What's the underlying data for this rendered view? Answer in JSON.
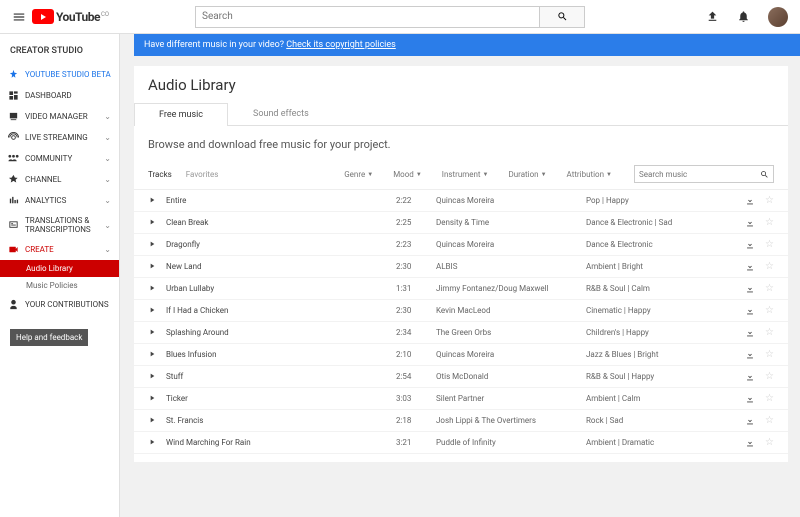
{
  "topbar": {
    "logo_text": "YouTube",
    "logo_sup": "CO",
    "search_placeholder": "Search"
  },
  "sidebar": {
    "title": "CREATOR STUDIO",
    "items": [
      {
        "label": "YOUTUBE STUDIO BETA",
        "cls": "beta"
      },
      {
        "label": "DASHBOARD"
      },
      {
        "label": "VIDEO MANAGER",
        "exp": true
      },
      {
        "label": "LIVE STREAMING",
        "exp": true
      },
      {
        "label": "COMMUNITY",
        "exp": true
      },
      {
        "label": "CHANNEL",
        "exp": true
      },
      {
        "label": "ANALYTICS",
        "exp": true
      },
      {
        "label": "TRANSLATIONS & TRANSCRIPTIONS",
        "exp": true
      },
      {
        "label": "CREATE",
        "cls": "create",
        "exp": true
      },
      {
        "label": "YOUR CONTRIBUTIONS"
      }
    ],
    "subs": [
      {
        "label": "Audio Library",
        "active": true
      },
      {
        "label": "Music Policies"
      }
    ],
    "help": "Help and feedback"
  },
  "banner": {
    "text": "Have different music in your video? ",
    "link": "Check its copyright policies"
  },
  "page": {
    "title": "Audio Library",
    "tabs": [
      {
        "label": "Free music",
        "active": true
      },
      {
        "label": "Sound effects"
      }
    ],
    "subtitle": "Browse and download free music for your project.",
    "filter_tabs": [
      {
        "label": "Tracks",
        "active": true
      },
      {
        "label": "Favorites"
      }
    ],
    "filters": [
      "Genre",
      "Mood",
      "Instrument",
      "Duration",
      "Attribution"
    ],
    "search_placeholder": "Search music"
  },
  "tracks": [
    {
      "name": "Entire",
      "dur": "2:22",
      "artist": "Quincas Moreira",
      "genre": "Pop | Happy"
    },
    {
      "name": "Clean Break",
      "dur": "2:25",
      "artist": "Density & Time",
      "genre": "Dance & Electronic | Sad"
    },
    {
      "name": "Dragonfly",
      "dur": "2:23",
      "artist": "Quincas Moreira",
      "genre": "Dance & Electronic"
    },
    {
      "name": "New Land",
      "dur": "2:30",
      "artist": "ALBIS",
      "genre": "Ambient | Bright"
    },
    {
      "name": "Urban Lullaby",
      "dur": "1:31",
      "artist": "Jimmy Fontanez/Doug Maxwell",
      "genre": "R&B & Soul | Calm"
    },
    {
      "name": "If I Had a Chicken",
      "dur": "2:30",
      "artist": "Kevin MacLeod",
      "genre": "Cinematic | Happy"
    },
    {
      "name": "Splashing Around",
      "dur": "2:34",
      "artist": "The Green Orbs",
      "genre": "Children's | Happy"
    },
    {
      "name": "Blues Infusion",
      "dur": "2:10",
      "artist": "Quincas Moreira",
      "genre": "Jazz & Blues | Bright"
    },
    {
      "name": "Stuff",
      "dur": "2:54",
      "artist": "Otis McDonald",
      "genre": "R&B & Soul | Happy"
    },
    {
      "name": "Ticker",
      "dur": "3:03",
      "artist": "Silent Partner",
      "genre": "Ambient | Calm"
    },
    {
      "name": "St. Francis",
      "dur": "2:18",
      "artist": "Josh Lippi & The Overtimers",
      "genre": "Rock | Sad"
    },
    {
      "name": "Wind Marching For Rain",
      "dur": "3:21",
      "artist": "Puddle of Infinity",
      "genre": "Ambient | Dramatic"
    }
  ]
}
